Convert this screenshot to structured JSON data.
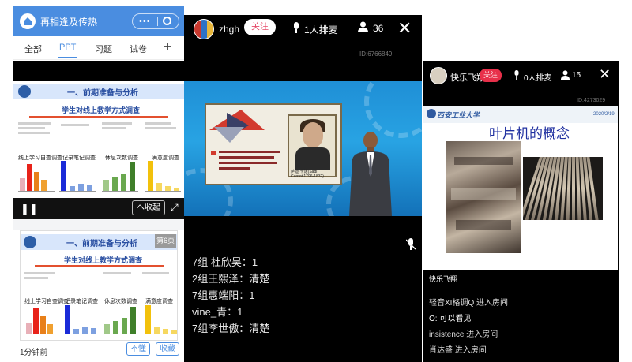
{
  "left_panel": {
    "title": "再相逢及传热",
    "tabs": [
      "全部",
      "PPT",
      "习题",
      "试卷"
    ],
    "active_tab": "PPT",
    "add_label": "+",
    "slide_heading": "一、前期准备与分析",
    "slide_subheading": "学生对线上教学方式调查",
    "slide_group_labels": [
      "线上学习自查调查",
      "记录笔记调查",
      "休息次数调查",
      "满意度调查"
    ],
    "pause_icon": "pause-icon",
    "collapse_label": "へ收起",
    "second_slide_page": "第6页",
    "time_label": "1分钟前",
    "dislike_label": "不懂",
    "favorite_label": "收藏",
    "accent_color": "#4a8de0"
  },
  "middle_panel": {
    "username": "zhgh",
    "follow_label": "关注",
    "queue_label": "1人排麦",
    "viewer_count": "36",
    "room_id": "ID:6766849",
    "portrait_caption": "萨迪·卡诺(Sadi Carnot,1796-1832)",
    "chat": [
      {
        "user": "7组 杜欣昊：",
        "text": "1"
      },
      {
        "user": "2组王熙泽：",
        "text": "清楚"
      },
      {
        "user": "7组惠端阳：",
        "text": "1"
      },
      {
        "user": "vine_青：",
        "text": "1"
      },
      {
        "user": "7组李世傲：",
        "text": "清楚"
      }
    ]
  },
  "right_panel": {
    "username": "快乐飞翔",
    "follow_label": "关注",
    "queue_label": "0人排麦",
    "viewer_count": "15",
    "room_id": "ID:4273029",
    "school_name": "西安工业大学",
    "slide_date": "2020/2/19",
    "slide_title": "叶片机的概念",
    "caption": "快乐飞翔",
    "chat": [
      "轻音XI格调Q 进入房间",
      "O: 可以看见",
      "insistence 进入房间",
      "肖达盛 进入房间"
    ]
  }
}
